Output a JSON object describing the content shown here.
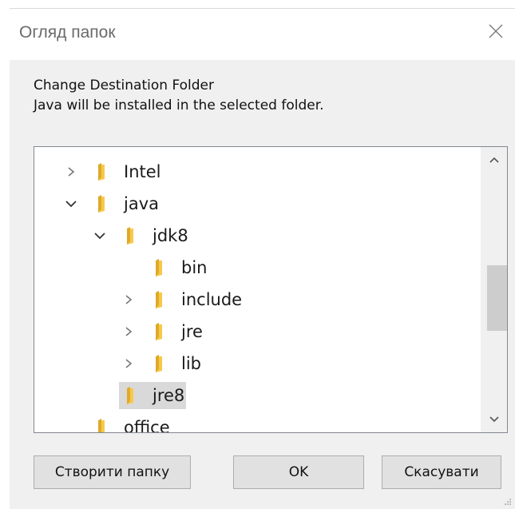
{
  "window": {
    "title": "Огляд папок",
    "close_icon": "close-icon"
  },
  "description": {
    "line1": "Change Destination Folder",
    "line2": "Java will be installed in the selected folder."
  },
  "tree": {
    "items": [
      {
        "label": "Intel",
        "expander": "chevron-right",
        "level": 1
      },
      {
        "label": "java",
        "expander": "chevron-down",
        "level": 1
      },
      {
        "label": "jdk8",
        "expander": "chevron-down",
        "level": 2
      },
      {
        "label": "bin",
        "expander": "none",
        "level": 3
      },
      {
        "label": "include",
        "expander": "chevron-right",
        "level": 3
      },
      {
        "label": "jre",
        "expander": "chevron-right",
        "level": 3
      },
      {
        "label": "lib",
        "expander": "chevron-right",
        "level": 3
      },
      {
        "label": "jre8",
        "expander": "none",
        "level": 2,
        "selected": true
      },
      {
        "label": "office",
        "expander": "none",
        "level": 1
      }
    ],
    "folder_color": "#f6c94b",
    "selection_color": "#d9d9d9"
  },
  "buttons": {
    "new_folder": "Створити папку",
    "ok": "OK",
    "cancel": "Скасувати"
  }
}
